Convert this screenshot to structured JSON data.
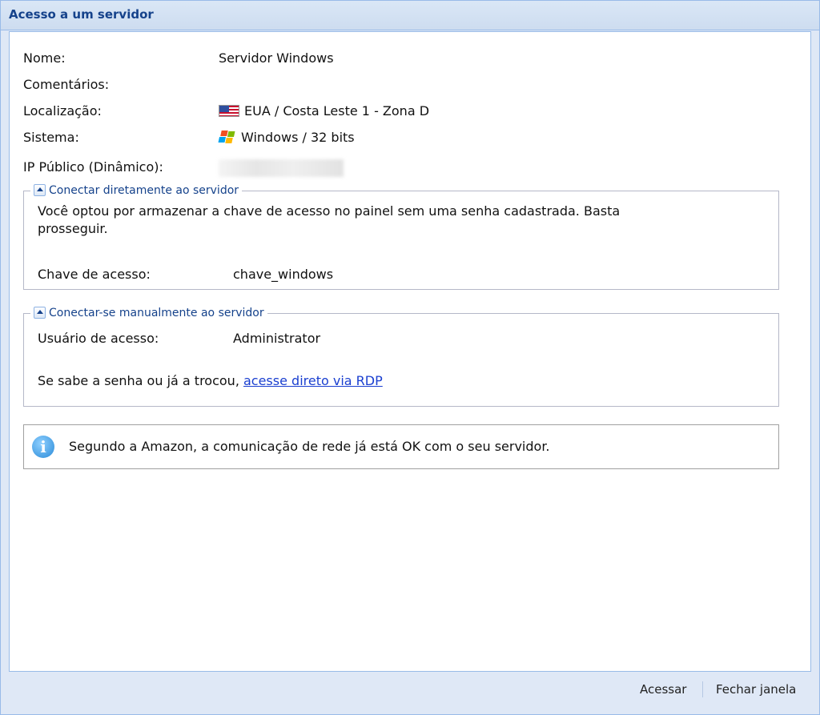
{
  "window": {
    "title": "Acesso a um servidor"
  },
  "details": [
    {
      "label": "Nome:",
      "value": "Servidor Windows"
    },
    {
      "label": "Comentários:",
      "value": ""
    },
    {
      "label": "Localização:",
      "value": "EUA / Costa Leste 1 - Zona D",
      "icon": "us-flag-icon"
    },
    {
      "label": "Sistema:",
      "value": "Windows / 32 bits",
      "icon": "windows-logo-icon"
    },
    {
      "label": "IP Público (Dinâmico):",
      "value": ""
    }
  ],
  "direct": {
    "legend": "Conectar diretamente ao servidor",
    "description_line1": "Você optou por armazenar a chave de acesso no painel sem uma senha cadastrada. Basta",
    "description_line2": "prosseguir.",
    "key_label": "Chave de acesso:",
    "key_value": "chave_windows"
  },
  "manual": {
    "legend": "Conectar-se manualmente ao servidor",
    "user_label": "Usuário de acesso:",
    "user_value": "Administrator",
    "rdp_prefix": "Se sabe a senha ou já a trocou, ",
    "rdp_link": "acesse direto via RDP"
  },
  "info": {
    "message": "Segundo a Amazon, a comunicação de rede já está OK com o seu servidor."
  },
  "footer": {
    "access_label": "Acessar",
    "close_label": "Fechar janela"
  },
  "colors": {
    "title": "#15428b",
    "frame": "#99bbe8",
    "link": "#1a3fd0"
  }
}
